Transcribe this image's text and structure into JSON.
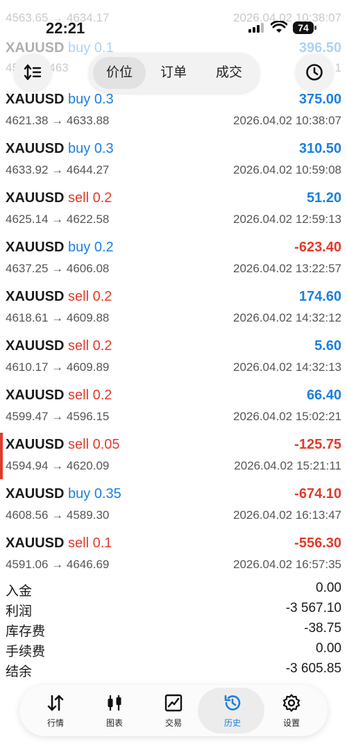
{
  "status_bar": {
    "time": "22:21",
    "battery": "74"
  },
  "ghost_rows": [
    {
      "price_text": "4563.65 → 4634.17",
      "date": "2026.04.02 10:38:07"
    },
    {
      "symbol": "XAUUSD",
      "side": "buy",
      "volume": "0.1",
      "result": "396.50",
      "price_text": "45… → 463",
      "date": ".04.02 1"
    }
  ],
  "segmented": {
    "items": [
      "价位",
      "订单",
      "成交"
    ],
    "selected": 0
  },
  "deals": [
    {
      "symbol": "XAUUSD",
      "side": "buy",
      "volume": "0.3",
      "prices": "4621.38 → 4633.88",
      "time": "2026.04.02 10:38:07",
      "result": "375.00",
      "positive": true
    },
    {
      "symbol": "XAUUSD",
      "side": "buy",
      "volume": "0.3",
      "prices": "4633.92 → 4644.27",
      "time": "2026.04.02 10:59:08",
      "result": "310.50",
      "positive": true
    },
    {
      "symbol": "XAUUSD",
      "side": "sell",
      "volume": "0.2",
      "prices": "4625.14 → 4622.58",
      "time": "2026.04.02 12:59:13",
      "result": "51.20",
      "positive": true
    },
    {
      "symbol": "XAUUSD",
      "side": "buy",
      "volume": "0.2",
      "prices": "4637.25 → 4606.08",
      "time": "2026.04.02 13:22:57",
      "result": "-623.40",
      "positive": false
    },
    {
      "symbol": "XAUUSD",
      "side": "sell",
      "volume": "0.2",
      "prices": "4618.61 → 4609.88",
      "time": "2026.04.02 14:32:12",
      "result": "174.60",
      "positive": true
    },
    {
      "symbol": "XAUUSD",
      "side": "sell",
      "volume": "0.2",
      "prices": "4610.17 → 4609.89",
      "time": "2026.04.02 14:32:13",
      "result": "5.60",
      "positive": true
    },
    {
      "symbol": "XAUUSD",
      "side": "sell",
      "volume": "0.2",
      "prices": "4599.47 → 4596.15",
      "time": "2026.04.02 15:02:21",
      "result": "66.40",
      "positive": true
    },
    {
      "symbol": "XAUUSD",
      "side": "sell",
      "volume": "0.05",
      "prices": "4594.94 → 4620.09",
      "time": "2026.04.02 15:21:11",
      "result": "-125.75",
      "positive": false,
      "marked": true
    },
    {
      "symbol": "XAUUSD",
      "side": "buy",
      "volume": "0.35",
      "prices": "4608.56 → 4589.30",
      "time": "2026.04.02 16:13:47",
      "result": "-674.10",
      "positive": false
    },
    {
      "symbol": "XAUUSD",
      "side": "sell",
      "volume": "0.1",
      "prices": "4591.06 → 4646.69",
      "time": "2026.04.02 16:57:35",
      "result": "-556.30",
      "positive": false
    }
  ],
  "summary": [
    {
      "label": "入金",
      "value": "0.00"
    },
    {
      "label": "利润",
      "value": "-3 567.10"
    },
    {
      "label": "库存费",
      "value": "-38.75"
    },
    {
      "label": "手续费",
      "value": "0.00"
    },
    {
      "label": "结余",
      "value": "-3 605.85"
    }
  ],
  "tabbar": {
    "items": [
      {
        "label": "行情",
        "icon": "quotes-arrows-icon"
      },
      {
        "label": "图表",
        "icon": "candlestick-chart-icon"
      },
      {
        "label": "交易",
        "icon": "trade-chart-icon"
      },
      {
        "label": "历史",
        "icon": "history-clock-icon"
      },
      {
        "label": "设置",
        "icon": "gear-icon"
      }
    ],
    "selected": 3
  },
  "colors": {
    "buy": "#1a7fe0",
    "sell": "#e23a2b",
    "active_tab": "#1a7fe0"
  }
}
